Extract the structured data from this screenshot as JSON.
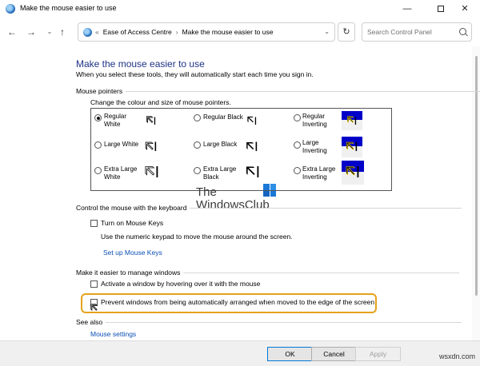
{
  "window": {
    "title": "Make the mouse easier to use",
    "minimize_glyph": "—",
    "close_glyph": "✕"
  },
  "navbar": {
    "back_glyph": "←",
    "forward_glyph": "→",
    "dropdown_glyph": "⌄",
    "up_glyph": "↑",
    "crumb_separator_start": "«",
    "crumb_separator": "›",
    "breadcrumb": [
      "Ease of Access Centre",
      "Make the mouse easier to use"
    ],
    "refresh_glyph": "↻",
    "search_placeholder": "Search Control Panel"
  },
  "page": {
    "title": "Make the mouse easier to use",
    "subtitle": "When you select these tools, they will automatically start each time you sign in."
  },
  "mouse_pointers": {
    "header": "Mouse pointers",
    "description": "Change the colour and size of mouse pointers.",
    "options": [
      {
        "label_line1": "Regular",
        "label_line2": "White",
        "selected": true,
        "style": "white"
      },
      {
        "label_line1": "Regular Black",
        "label_line2": "",
        "selected": false,
        "style": "black"
      },
      {
        "label_line1": "Regular",
        "label_line2": "Inverting",
        "selected": false,
        "style": "inverting"
      },
      {
        "label_line1": "Large White",
        "label_line2": "",
        "selected": false,
        "style": "white"
      },
      {
        "label_line1": "Large Black",
        "label_line2": "",
        "selected": false,
        "style": "black"
      },
      {
        "label_line1": "Large",
        "label_line2": "Inverting",
        "selected": false,
        "style": "inverting"
      },
      {
        "label_line1": "Extra Large",
        "label_line2": "White",
        "selected": false,
        "style": "white"
      },
      {
        "label_line1": "Extra Large",
        "label_line2": "Black",
        "selected": false,
        "style": "black"
      },
      {
        "label_line1": "Extra Large",
        "label_line2": "Inverting",
        "selected": false,
        "style": "inverting"
      }
    ]
  },
  "keyboard": {
    "header": "Control the mouse with the keyboard",
    "mouse_keys_label": "Turn on Mouse Keys",
    "mouse_keys_checked": false,
    "mouse_keys_description": "Use the numeric keypad to move the mouse around the screen.",
    "setup_link": "Set up Mouse Keys"
  },
  "windows": {
    "header": "Make it easier to manage windows",
    "hover_label": "Activate a window by hovering over it with the mouse",
    "hover_checked": false,
    "prevent_label": "Prevent windows from being automatically arranged when moved to the edge of the screen",
    "prevent_checked": false
  },
  "see_also": {
    "header": "See also",
    "mouse_settings_link": "Mouse settings"
  },
  "watermark": {
    "line1": "The",
    "line2": "WindowsClub"
  },
  "footer": {
    "ok": "OK",
    "cancel": "Cancel",
    "apply": "Apply",
    "site_mark": "wsxdn.com"
  },
  "colors": {
    "title_blue": "#1e3287",
    "link_blue": "#0b4fb4",
    "highlight_orange": "#e5a21b",
    "inverting_blue": "#0000c8"
  },
  "icons": {
    "pointer_arrow": "🡬",
    "text_ibeam": "I",
    "mouse_cursor": "🡬"
  }
}
